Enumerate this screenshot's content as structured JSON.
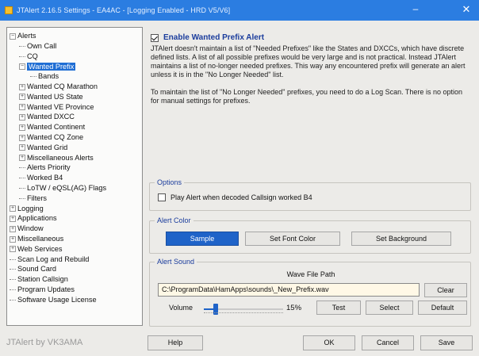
{
  "window": {
    "title": "JTAlert 2.16.5 Settings - EA4AC - [Logging Enabled - HRD V5/V6]",
    "minimize_glyph": "‒",
    "close_glyph": "✕",
    "titlebar_color": "#2b7de1"
  },
  "tree": {
    "items": [
      {
        "label": "Alerts",
        "expander": "−",
        "level": 0
      },
      {
        "label": "Own Call",
        "level": 1
      },
      {
        "label": "CQ",
        "level": 1
      },
      {
        "label": "Wanted Prefix",
        "expander": "−",
        "level": 1,
        "selected": true
      },
      {
        "label": "Bands",
        "level": 2
      },
      {
        "label": "Wanted CQ Marathon",
        "expander": "+",
        "level": 1
      },
      {
        "label": "Wanted US State",
        "expander": "+",
        "level": 1
      },
      {
        "label": "Wanted VE Province",
        "expander": "+",
        "level": 1
      },
      {
        "label": "Wanted DXCC",
        "expander": "+",
        "level": 1
      },
      {
        "label": "Wanted Continent",
        "expander": "+",
        "level": 1
      },
      {
        "label": "Wanted CQ Zone",
        "expander": "+",
        "level": 1
      },
      {
        "label": "Wanted Grid",
        "expander": "+",
        "level": 1
      },
      {
        "label": "Miscellaneous Alerts",
        "expander": "+",
        "level": 1
      },
      {
        "label": "Alerts Priority",
        "level": 1
      },
      {
        "label": "Worked B4",
        "level": 1
      },
      {
        "label": "LoTW / eQSL(AG) Flags",
        "level": 1
      },
      {
        "label": "Filters",
        "level": 1
      },
      {
        "label": "Logging",
        "expander": "+",
        "level": 0
      },
      {
        "label": "Applications",
        "expander": "+",
        "level": 0
      },
      {
        "label": "Window",
        "expander": "+",
        "level": 0
      },
      {
        "label": "Miscellaneous",
        "expander": "+",
        "level": 0
      },
      {
        "label": "Web Services",
        "expander": "+",
        "level": 0
      },
      {
        "label": "Scan Log and Rebuild",
        "level": 0
      },
      {
        "label": "Sound Card",
        "level": 0
      },
      {
        "label": "Station Callsign",
        "level": 0
      },
      {
        "label": "Program Updates",
        "level": 0
      },
      {
        "label": "Software Usage License",
        "level": 0
      }
    ]
  },
  "panel": {
    "enable_label": "Enable Wanted Prefix Alert",
    "enable_checked": true,
    "description_1": "JTAlert doesn't maintain a list of \"Needed Prefixes\" like the States and DXCCs, which have discrete defined lists. A list of all possible prefixes would be very large and is not practical. Instead JTAlert maintains a list of no-longer needed prefixes. This way any encountered prefix will generate an alert unless it is in the \"No Longer Needed\" list.",
    "description_2": "To maintain the list of \"No Longer Needed\" prefixes, you need to do a Log Scan. There is no option for manual settings for prefixes."
  },
  "options": {
    "title": "Options",
    "play_b4_label": "Play Alert when decoded Callsign worked B4",
    "play_b4_checked": false
  },
  "alert_color": {
    "title": "Alert Color",
    "sample_label": "Sample",
    "font_color_label": "Set Font Color",
    "background_label": "Set Background",
    "sample_bg": "#1f63c8"
  },
  "alert_sound": {
    "title": "Alert Sound",
    "wave_label": "Wave File Path",
    "path_value": "C:\\ProgramData\\HamApps\\sounds\\_New_Prefix.wav",
    "clear_label": "Clear",
    "volume_label": "Volume",
    "volume_value": "15%",
    "volume_fraction": 0.15,
    "test_label": "Test",
    "select_label": "Select",
    "default_label": "Default"
  },
  "footer": {
    "brand": "JTAlert by VK3AMA",
    "help_label": "Help",
    "ok_label": "OK",
    "cancel_label": "Cancel",
    "save_label": "Save"
  }
}
